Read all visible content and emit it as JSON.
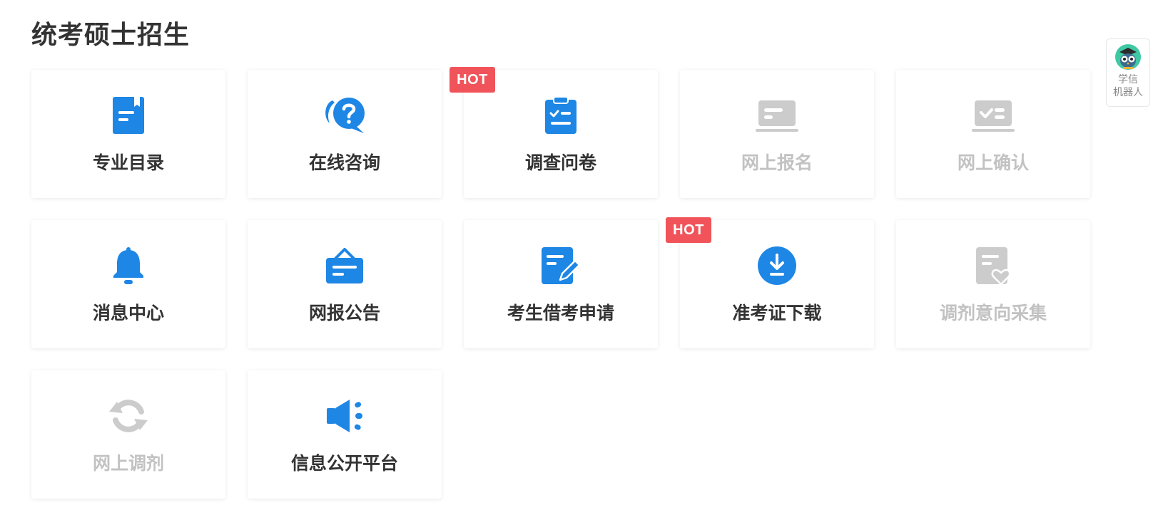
{
  "page": {
    "title": "统考硕士招生"
  },
  "colors": {
    "accent": "#1e86e5",
    "disabled": "#cccccc",
    "hot": "#f0545a"
  },
  "cards": [
    {
      "label": "专业目录",
      "icon": "book-icon",
      "disabled": false,
      "hot": false
    },
    {
      "label": "在线咨询",
      "icon": "question-chat-icon",
      "disabled": false,
      "hot": false
    },
    {
      "label": "调查问卷",
      "icon": "clipboard-check-icon",
      "disabled": false,
      "hot": true,
      "badge": "HOT"
    },
    {
      "label": "网上报名",
      "icon": "laptop-form-icon",
      "disabled": true,
      "hot": false
    },
    {
      "label": "网上确认",
      "icon": "laptop-check-icon",
      "disabled": true,
      "hot": false
    },
    {
      "label": "消息中心",
      "icon": "bell-icon",
      "disabled": false,
      "hot": false
    },
    {
      "label": "网报公告",
      "icon": "notice-board-icon",
      "disabled": false,
      "hot": false
    },
    {
      "label": "考生借考申请",
      "icon": "edit-document-icon",
      "disabled": false,
      "hot": false
    },
    {
      "label": "准考证下载",
      "icon": "download-circle-icon",
      "disabled": false,
      "hot": true,
      "badge": "HOT"
    },
    {
      "label": "调剂意向采集",
      "icon": "document-heart-icon",
      "disabled": true,
      "hot": false
    },
    {
      "label": "网上调剂",
      "icon": "refresh-icon",
      "disabled": true,
      "hot": false
    },
    {
      "label": "信息公开平台",
      "icon": "megaphone-icon",
      "disabled": false,
      "hot": false
    }
  ],
  "robot": {
    "label_line1": "学信",
    "label_line2": "机器人",
    "icon": "owl-avatar-icon"
  }
}
